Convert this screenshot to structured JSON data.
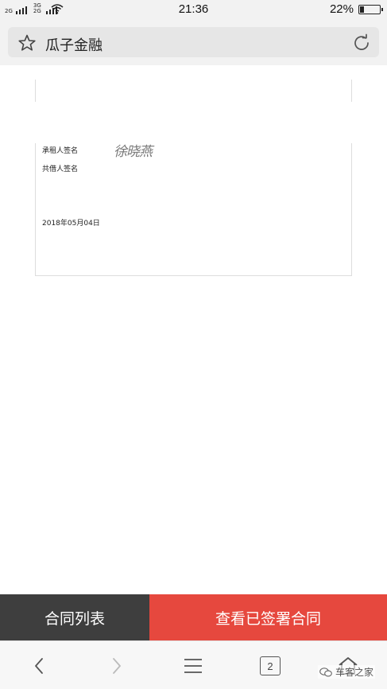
{
  "status_bar": {
    "sim1_label": "2G",
    "sim2_label": "3G",
    "sim2_sub_label": "2G",
    "time": "21:36",
    "battery_percent": "22%",
    "battery_level": 0.22
  },
  "header": {
    "title": "瓜子金融"
  },
  "document": {
    "lessee_signature_label": "承租人签名",
    "co_borrower_signature_label": "共借人签名",
    "signature_text": "徐晓燕",
    "date": "2018年05月04日"
  },
  "actions": {
    "contract_list_label": "合同列表",
    "view_signed_label": "查看已签署合同"
  },
  "browser_nav": {
    "tab_count": "2"
  },
  "watermark": {
    "text": "车客之家"
  },
  "icons": {
    "favorite": "star-icon",
    "reload": "refresh-icon",
    "back": "chevron-left-icon",
    "forward": "chevron-right-icon",
    "menu": "menu-icon",
    "home": "home-icon"
  }
}
